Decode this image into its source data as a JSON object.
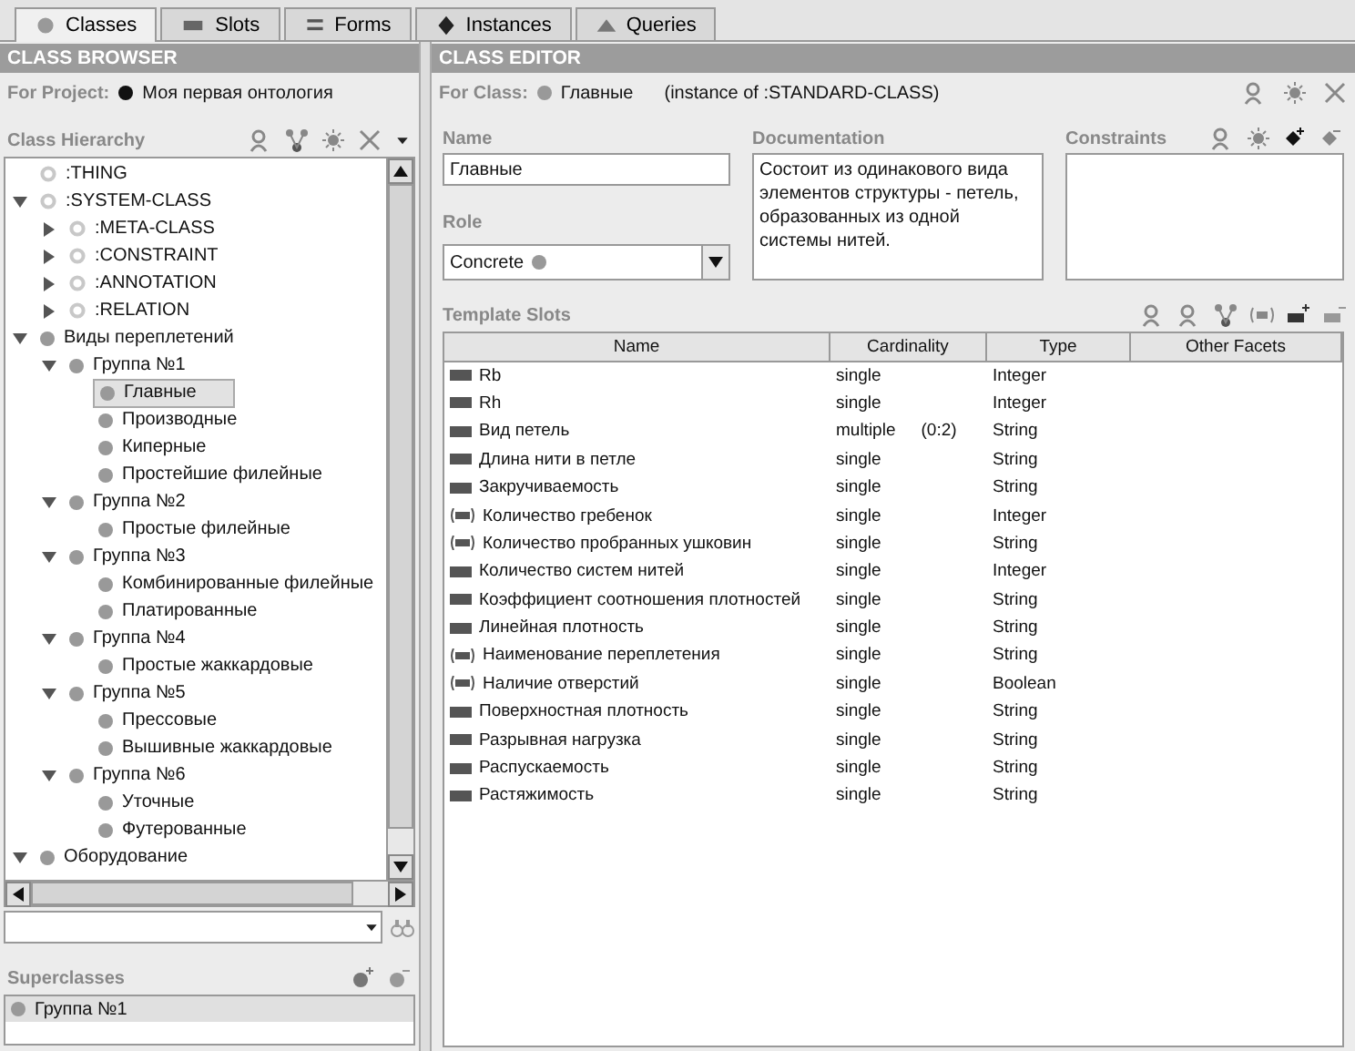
{
  "tabs": [
    {
      "label": "Classes",
      "selected": true
    },
    {
      "label": "Slots",
      "selected": false
    },
    {
      "label": "Forms",
      "selected": false
    },
    {
      "label": "Instances",
      "selected": false
    },
    {
      "label": "Queries",
      "selected": false
    }
  ],
  "class_browser": {
    "title": "CLASS BROWSER",
    "project_label": "For Project:",
    "project_name": "Моя первая онтология",
    "hierarchy_label": "Class Hierarchy",
    "tree": [
      {
        "label": ":THING",
        "kind": "system"
      },
      {
        "label": ":SYSTEM-CLASS",
        "kind": "system",
        "expanded": true,
        "selected": false,
        "children": [
          {
            "label": ":META-CLASS",
            "kind": "system",
            "expanded": false,
            "selected": false
          },
          {
            "label": ":CONSTRAINT",
            "kind": "system",
            "expanded": false,
            "selected": false
          },
          {
            "label": ":ANNOTATION",
            "kind": "system",
            "expanded": false,
            "selected": false
          },
          {
            "label": ":RELATION",
            "kind": "system",
            "expanded": false,
            "selected": false
          }
        ]
      },
      {
        "label": "Виды переплетений",
        "kind": "class",
        "expanded": true,
        "selected": false,
        "children": [
          {
            "label": "Группа №1",
            "kind": "class",
            "expanded": true,
            "selected": false,
            "children": [
              {
                "label": "Главные",
                "kind": "class",
                "selected": true
              },
              {
                "label": "Производные",
                "kind": "class",
                "selected": false
              },
              {
                "label": "Киперные",
                "kind": "class",
                "selected": false
              },
              {
                "label": "Простейшие филейные",
                "kind": "class",
                "selected": false
              }
            ]
          },
          {
            "label": "Группа №2",
            "kind": "class",
            "expanded": true,
            "selected": false,
            "children": [
              {
                "label": "Простые филейные",
                "kind": "class",
                "selected": false
              }
            ]
          },
          {
            "label": "Группа №3",
            "kind": "class",
            "expanded": true,
            "selected": false,
            "children": [
              {
                "label": "Комбинированные филейные",
                "kind": "class",
                "selected": false
              },
              {
                "label": "Платированные",
                "kind": "class",
                "selected": false
              }
            ]
          },
          {
            "label": "Группа №4",
            "kind": "class",
            "expanded": true,
            "selected": false,
            "children": [
              {
                "label": "Простые жаккардовые",
                "kind": "class",
                "selected": false
              }
            ]
          },
          {
            "label": "Группа №5",
            "kind": "class",
            "expanded": true,
            "selected": false,
            "children": [
              {
                "label": "Прессовые",
                "kind": "class",
                "selected": false
              },
              {
                "label": "Вышивные жаккардовые",
                "kind": "class",
                "selected": false
              }
            ]
          },
          {
            "label": "Группа №6",
            "kind": "class",
            "expanded": true,
            "selected": false,
            "children": [
              {
                "label": "Уточные",
                "kind": "class",
                "selected": false
              },
              {
                "label": "Футерованные",
                "kind": "class",
                "selected": false
              }
            ]
          }
        ]
      },
      {
        "label": "Оборудование",
        "kind": "class",
        "expanded": true,
        "selected": false
      }
    ],
    "superclasses_label": "Superclasses",
    "superclasses": [
      "Группа №1"
    ]
  },
  "class_editor": {
    "title": "CLASS EDITOR",
    "for_class_label": "For Class:",
    "class_name": "Главные",
    "instance_of": "(instance of :STANDARD-CLASS)",
    "name_label": "Name",
    "name_value": "Главные",
    "role_label": "Role",
    "role_value": "Concrete",
    "documentation_label": "Documentation",
    "documentation": "Состоит из одинакового вида элементов структуры - петель, образованных из одной системы нитей.",
    "constraints_label": "Constraints",
    "template_slots_label": "Template Slots",
    "columns": [
      "Name",
      "Cardinality",
      "Type",
      "Other Facets"
    ],
    "slots": [
      {
        "kind": "own",
        "name": "Rb",
        "cardinality": "single",
        "type": "Integer"
      },
      {
        "kind": "own",
        "name": "Rh",
        "cardinality": "single",
        "type": "Integer"
      },
      {
        "kind": "own",
        "name": "Вид петель",
        "cardinality": "multiple",
        "range": "(0:2)",
        "type": "String"
      },
      {
        "kind": "own",
        "name": "Длина нити в петле",
        "cardinality": "single",
        "type": "String"
      },
      {
        "kind": "own",
        "name": "Закручиваемость",
        "cardinality": "single",
        "type": "String"
      },
      {
        "kind": "inherited",
        "name": "Количество гребенок",
        "cardinality": "single",
        "type": "Integer"
      },
      {
        "kind": "inherited",
        "name": "Количество пробранных ушковин",
        "cardinality": "single",
        "type": "String"
      },
      {
        "kind": "own",
        "name": "Количество систем нитей",
        "cardinality": "single",
        "type": "Integer"
      },
      {
        "kind": "own",
        "name": "Коэффициент соотношения плотностей",
        "cardinality": "single",
        "type": "String"
      },
      {
        "kind": "own",
        "name": "Линейная плотность",
        "cardinality": "single",
        "type": "String"
      },
      {
        "kind": "inherited",
        "name": "Наименование переплетения",
        "cardinality": "single",
        "type": "String"
      },
      {
        "kind": "inherited",
        "name": "Наличие отверстий",
        "cardinality": "single",
        "type": "Boolean"
      },
      {
        "kind": "own",
        "name": "Поверхностная плотность",
        "cardinality": "single",
        "type": "String"
      },
      {
        "kind": "own",
        "name": "Разрывная нагрузка",
        "cardinality": "single",
        "type": "String"
      },
      {
        "kind": "own",
        "name": "Распускаемость",
        "cardinality": "single",
        "type": "String"
      },
      {
        "kind": "own",
        "name": "Растяжимость",
        "cardinality": "single",
        "type": "String"
      }
    ]
  }
}
